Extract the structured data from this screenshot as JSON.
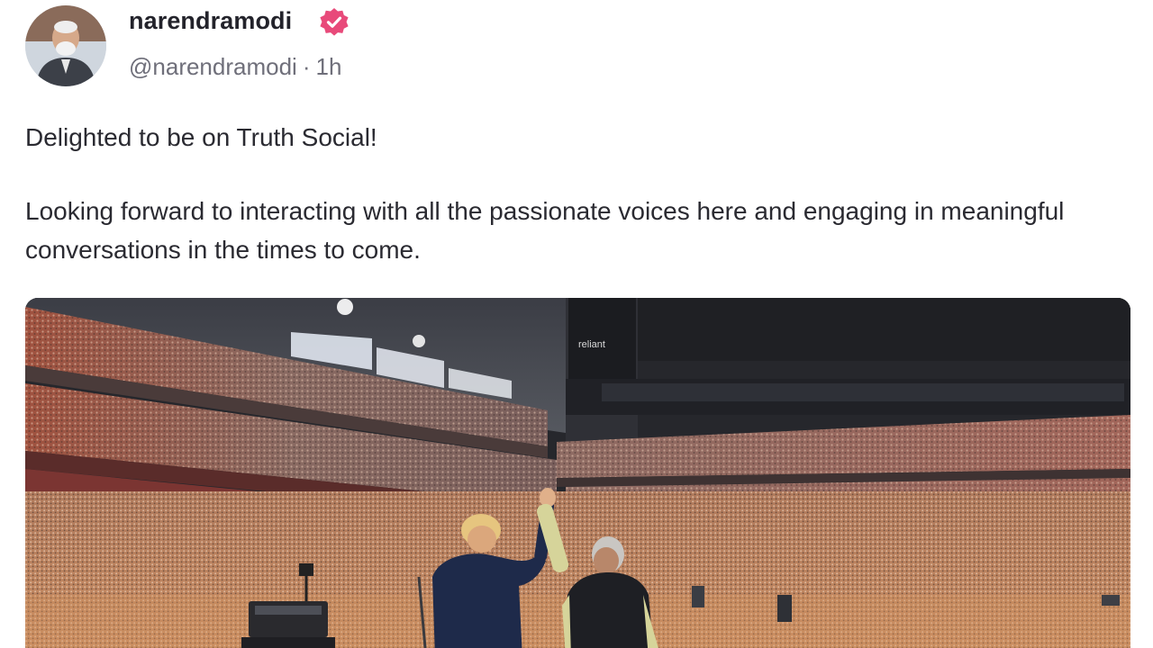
{
  "post": {
    "author": {
      "display_name": "narendramodi",
      "handle": "@narendramodi",
      "verified": true,
      "avatar_icon": "user-avatar-icon"
    },
    "timestamp": "1h",
    "separator": "·",
    "paragraphs": [
      "Delighted to be on Truth Social!",
      "Looking forward to interacting with all the passionate voices here and engaging in meaningful conversations in the times to come."
    ],
    "media": {
      "type": "photo",
      "banner_text": "reliant"
    }
  },
  "colors": {
    "verified_badge": "#e84a7a",
    "name_text": "#23232b",
    "meta_text": "#6f6f7a",
    "body_text": "#2a2a31"
  }
}
